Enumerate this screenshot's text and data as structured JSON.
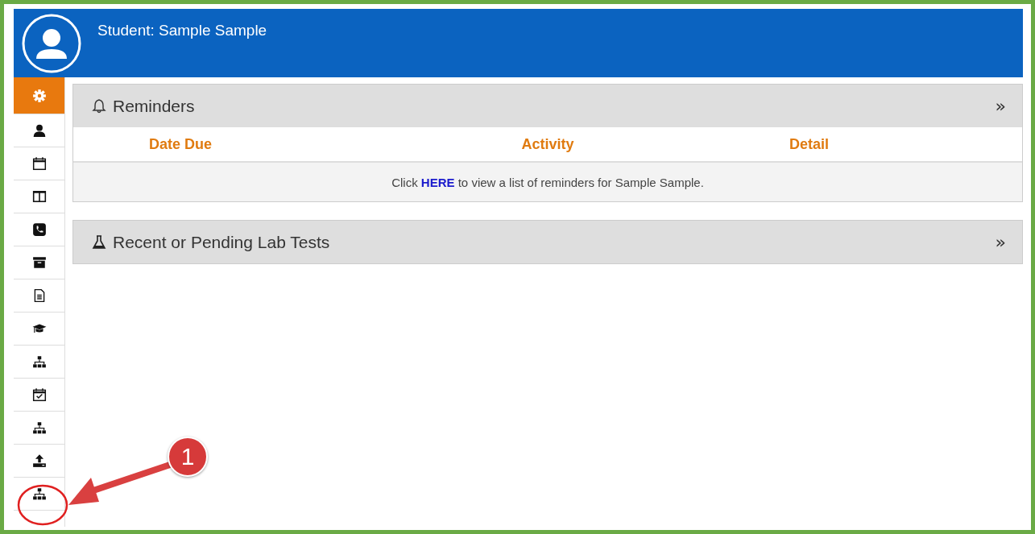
{
  "header": {
    "title": "Student: Sample Sample"
  },
  "sidebar": {
    "items": [
      {
        "selected": true
      },
      {
        "selected": false
      },
      {
        "selected": false
      },
      {
        "selected": false
      },
      {
        "selected": false
      },
      {
        "selected": false
      },
      {
        "selected": false
      },
      {
        "selected": false
      },
      {
        "selected": false
      },
      {
        "selected": false
      },
      {
        "selected": false
      },
      {
        "selected": false
      },
      {
        "selected": false
      }
    ]
  },
  "reminders": {
    "title": "Reminders",
    "expand": "»",
    "columns": [
      "Date Due",
      "Activity",
      "Detail"
    ],
    "message": {
      "before": "Click ",
      "link": "HERE",
      "after": " to view a list of reminders for Sample Sample."
    }
  },
  "lab_tests": {
    "title": "Recent or Pending Lab Tests",
    "expand": "»"
  },
  "callout": {
    "number": "1"
  }
}
